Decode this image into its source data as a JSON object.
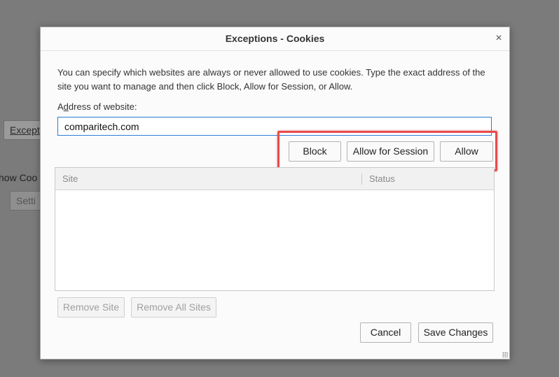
{
  "background": {
    "exceptions_fragment": "Except",
    "show_cookies_fragment": "how Coo",
    "settings_fragment": "Setti"
  },
  "dialog": {
    "title": "Exceptions - Cookies",
    "close_glyph": "×",
    "description": "You can specify which websites are always or never allowed to use cookies. Type the exact address of the site you want to manage and then click Block, Allow for Session, or Allow.",
    "address_label": "Address of website:",
    "address_value": "comparitech.com",
    "buttons": {
      "block": "Block",
      "allow_session": "Allow for Session",
      "allow": "Allow",
      "remove_site": "Remove Site",
      "remove_all": "Remove All Sites",
      "cancel": "Cancel",
      "save": "Save Changes"
    },
    "table": {
      "columns": [
        "Site",
        "Status"
      ],
      "rows": []
    }
  },
  "colors": {
    "highlight": "#e84b4b",
    "focus_border": "#2b7dd6"
  }
}
